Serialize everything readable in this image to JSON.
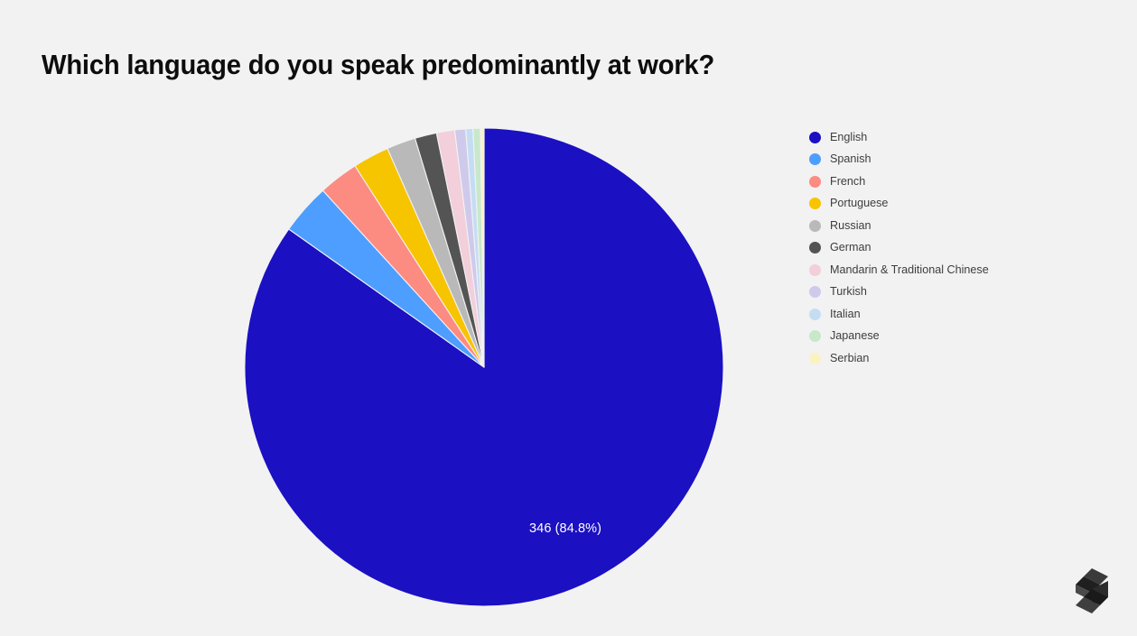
{
  "background_color": "#f2f2f2",
  "title": "Which language do you speak predominantly at work?",
  "pie_label": "346 (84.8%)",
  "legend": {
    "items": [
      {
        "label": "English",
        "color": "#1b10c2"
      },
      {
        "label": "Spanish",
        "color": "#4d9eff"
      },
      {
        "label": "French",
        "color": "#fc8b82"
      },
      {
        "label": "Portuguese",
        "color": "#f7c400"
      },
      {
        "label": "Russian",
        "color": "#b9b9b9"
      },
      {
        "label": "German",
        "color": "#545454"
      },
      {
        "label": "Mandarin & Traditional Chinese",
        "color": "#f2cfda"
      },
      {
        "label": "Turkish",
        "color": "#cfcaec"
      },
      {
        "label": "Italian",
        "color": "#c5ddf3"
      },
      {
        "label": "Japanese",
        "color": "#c8e8cb"
      },
      {
        "label": "Serbian",
        "color": "#fbf2c4"
      }
    ]
  },
  "logo": {
    "name": "faceted-s-logo",
    "color": "#2e2e2e"
  },
  "chart_data": {
    "type": "pie",
    "title": "Which language do you speak predominantly at work?",
    "total": 408,
    "legend_position": "right",
    "start_angle_deg": 0,
    "direction": "clockwise",
    "center": {
      "x": 536,
      "y": 407
    },
    "radius": 265,
    "labels": [
      "English",
      "Spanish",
      "French",
      "Portuguese",
      "Russian",
      "German",
      "Mandarin & Traditional Chinese",
      "Turkish",
      "Italian",
      "Japanese",
      "Serbian"
    ],
    "values": [
      346,
      14,
      11,
      10,
      8,
      6,
      5,
      3,
      2,
      2,
      1
    ],
    "percentages": [
      84.8,
      3.4,
      2.7,
      2.5,
      2.0,
      1.5,
      1.2,
      0.7,
      0.5,
      0.5,
      0.2
    ],
    "colors": [
      "#1b10c2",
      "#4d9eff",
      "#fc8b82",
      "#f7c400",
      "#b9b9b9",
      "#545454",
      "#f2cfda",
      "#cfcaec",
      "#c5ddf3",
      "#c8e8cb",
      "#fbf2c4"
    ],
    "data_labels": [
      {
        "label": "346 (84.8%)",
        "series": "English"
      }
    ]
  }
}
